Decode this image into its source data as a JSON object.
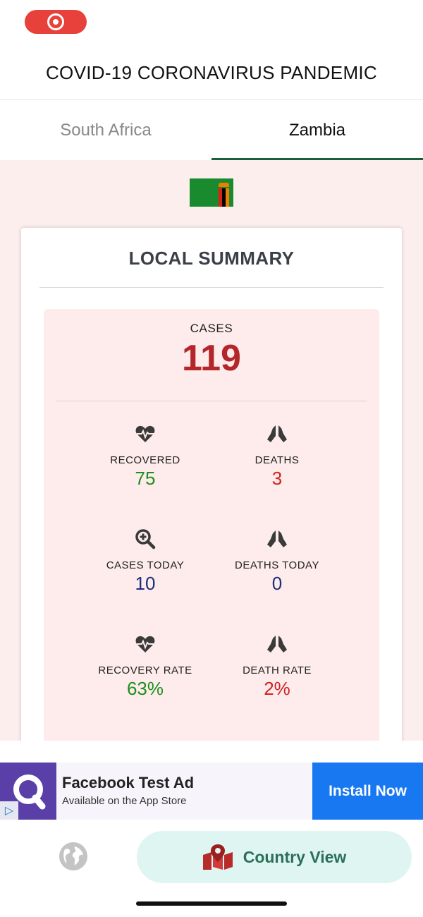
{
  "header": {
    "title": "COVID-19 CORONAVIRUS PANDEMIC"
  },
  "tabs": [
    {
      "label": "South Africa",
      "active": false
    },
    {
      "label": "Zambia",
      "active": true
    }
  ],
  "flag": {
    "country": "Zambia",
    "colors": {
      "field": "#1a8a2e",
      "red": "#de2010",
      "black": "#000000",
      "orange": "#ef7d00"
    }
  },
  "summary": {
    "title": "LOCAL SUMMARY",
    "cases_label": "CASES",
    "cases_value": "119",
    "stats": [
      {
        "icon": "heartbeat-icon",
        "label": "RECOVERED",
        "value": "75"
      },
      {
        "icon": "praying-hands-icon",
        "label": "DEATHS",
        "value": "3"
      },
      {
        "icon": "search-plus-icon",
        "label": "CASES TODAY",
        "value": "10"
      },
      {
        "icon": "praying-hands-icon",
        "label": "DEATHS TODAY",
        "value": "0"
      },
      {
        "icon": "heartbeat-icon",
        "label": "RECOVERY RATE",
        "value": "63%"
      },
      {
        "icon": "praying-hands-icon",
        "label": "DEATH RATE",
        "value": "2%"
      }
    ]
  },
  "ad": {
    "title": "Facebook Test Ad",
    "subtitle": "Available on the App Store",
    "install_label": "Install Now",
    "colors": {
      "logo_bg": "#5b3fa8",
      "button_bg": "#1878f2"
    }
  },
  "bottom_nav": {
    "globe_icon": "globe-icon",
    "country_view_label": "Country View",
    "country_view_icon": "map-marker-icon"
  },
  "colors": {
    "accent": "#1b5e3a",
    "cases": "#b3262a",
    "recovered": "#1e8f1e",
    "deaths": "#d42020",
    "today": "#1c2f7a"
  }
}
